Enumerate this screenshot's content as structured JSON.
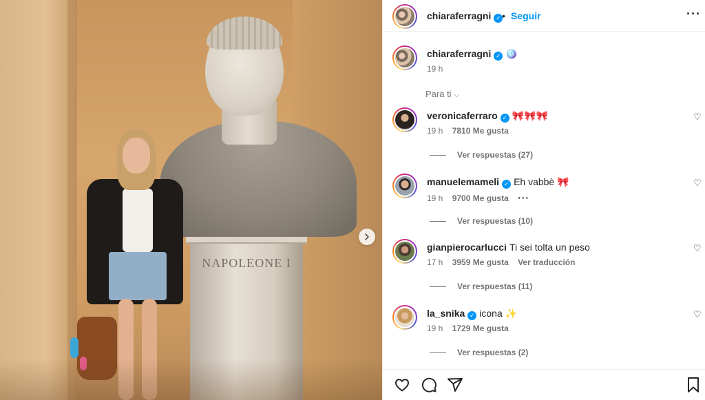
{
  "post": {
    "inscription": "NAPOLEONE I",
    "next_icon": "chevron-right-icon"
  },
  "header": {
    "username": "chiaraferragni",
    "separator": "•",
    "follow_label": "Seguir",
    "more_icon": "more-horizontal-icon",
    "more_label": "···"
  },
  "caption": {
    "username": "chiaraferragni",
    "emoji": "🪩",
    "time": "19 h"
  },
  "sort": {
    "label": "Para ti",
    "chevron": "⌵"
  },
  "comments": [
    {
      "username": "veronicaferraro",
      "verified": true,
      "text": "🎀🎀🎀",
      "time": "19 h",
      "likes": "7810 Me gusta",
      "extra": "",
      "replies": "Ver respuestas (27)"
    },
    {
      "username": "manuelemameli",
      "verified": true,
      "text": "Eh vabbè 🎀",
      "time": "19 h",
      "likes": "9700 Me gusta",
      "extra": "···",
      "replies": "Ver respuestas (10)"
    },
    {
      "username": "gianpierocarlucci",
      "verified": false,
      "text": "Ti sei tolta un peso",
      "time": "17 h",
      "likes": "3959 Me gusta",
      "extra": "Ver traducción",
      "replies": "Ver respuestas (11)"
    },
    {
      "username": "la_snika",
      "verified": true,
      "text": "icona ✨",
      "time": "19 h",
      "likes": "1729 Me gusta",
      "extra": "",
      "replies": "Ver respuestas (2)"
    }
  ],
  "icons": {
    "verified": "✓",
    "heart": "♡"
  },
  "colors": {
    "accent": "#0095f6",
    "text": "#262626",
    "secondary": "#737373"
  }
}
